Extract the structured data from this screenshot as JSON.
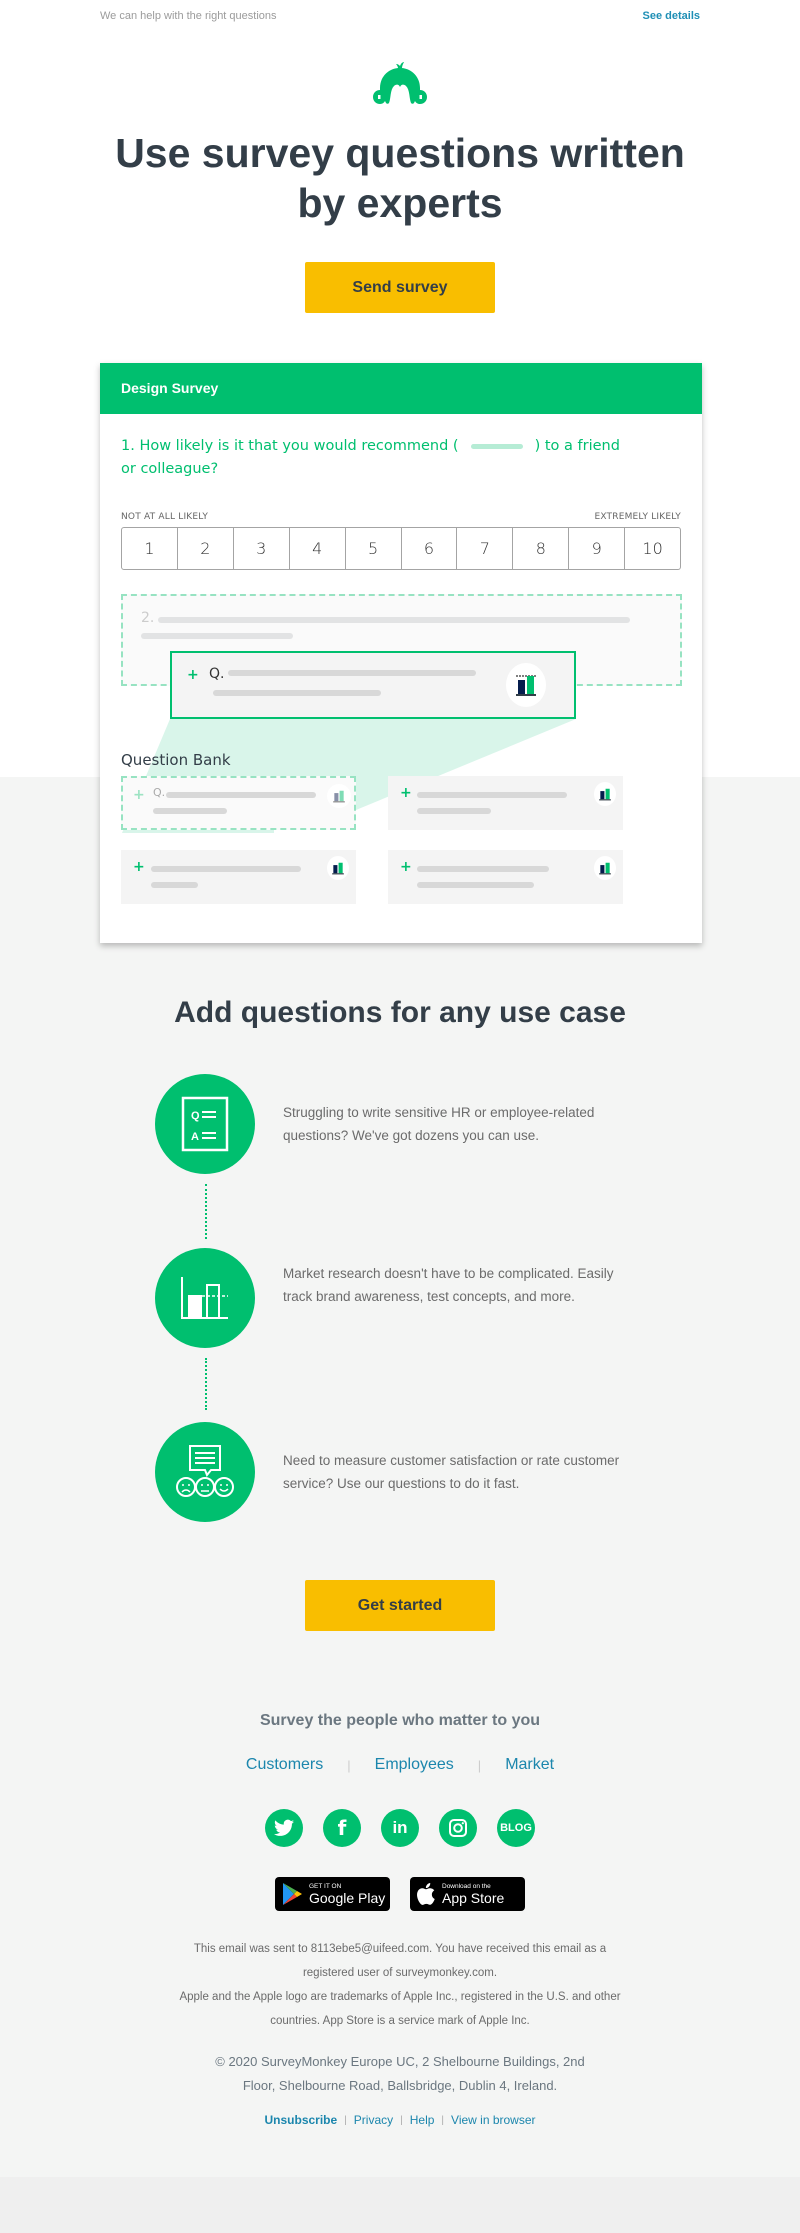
{
  "preheader": {
    "text": "We can help with the right questions",
    "link": "See details"
  },
  "brand": {
    "logo_icon": "surveymonkey-logo-icon",
    "accent": "#00bf6f",
    "cta": "#f9be00",
    "link": "#1b86ad"
  },
  "hero": {
    "title": "Use survey questions written by experts",
    "button": "Send survey"
  },
  "survey_card": {
    "header": "Design Survey",
    "question1_prefix": "1. How likely is it that you would recommend (",
    "question1_suffix": ") to a friend or colleague?",
    "scale_low_label": "NOT AT ALL LIKELY",
    "scale_high_label": "EXTREMELY LIKELY",
    "scale": [
      "1",
      "2",
      "3",
      "4",
      "5",
      "6",
      "7",
      "8",
      "9",
      "10"
    ],
    "question2_number": "2.",
    "drag_item": {
      "plus": "+",
      "label": "Q."
    },
    "question_bank_title": "Question Bank",
    "bank_items": [
      {
        "plus": "+",
        "label": "Q.",
        "state": "ghost"
      },
      {
        "plus": "+",
        "label": ""
      },
      {
        "plus": "+",
        "label": ""
      },
      {
        "plus": "+",
        "label": ""
      }
    ]
  },
  "use_cases": {
    "title": "Add questions for any use case",
    "items": [
      {
        "icon": "qa-document-icon",
        "text": "Struggling to write sensitive HR or employee-related questions? We've got dozens you can use."
      },
      {
        "icon": "bar-chart-icon",
        "text": "Market research doesn't have to be complicated. Easily track brand awareness, test concepts, and more."
      },
      {
        "icon": "feedback-faces-icon",
        "text": "Need to measure customer satisfaction or rate customer service? Use our questions to do it fast."
      }
    ],
    "button": "Get started"
  },
  "audience": {
    "title": "Survey the people who matter to you",
    "links": [
      "Customers",
      "Employees",
      "Market"
    ]
  },
  "social": [
    {
      "name": "twitter",
      "icon": "twitter-icon"
    },
    {
      "name": "facebook",
      "icon": "facebook-icon",
      "glyph": "f"
    },
    {
      "name": "linkedin",
      "icon": "linkedin-icon",
      "glyph": "in"
    },
    {
      "name": "instagram",
      "icon": "instagram-icon"
    },
    {
      "name": "blog",
      "icon": "blog-icon",
      "glyph": "BLOG"
    }
  ],
  "stores": {
    "google": {
      "small": "GET IT ON",
      "big": "Google Play"
    },
    "apple": {
      "small": "Download on the",
      "big": "App Store"
    }
  },
  "legal": {
    "line1": "This email was sent to 8113ebe5@uifeed.com. You have received this email as a registered user of surveymonkey.com.",
    "line2": "Apple and the Apple logo are trademarks of Apple Inc., registered in the U.S. and other countries. App Store is a service mark of Apple Inc.",
    "address": "© 2020 SurveyMonkey Europe UC, 2 Shelbourne Buildings, 2nd Floor, Shelbourne Road, Ballsbridge, Dublin 4, Ireland."
  },
  "footer_links": [
    "Unsubscribe",
    "Privacy",
    "Help",
    "View in browser"
  ]
}
